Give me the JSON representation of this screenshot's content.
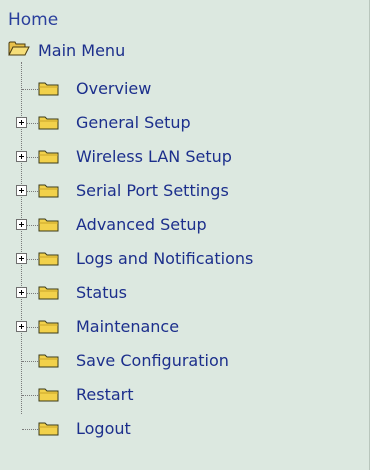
{
  "nav": {
    "home_label": "Home",
    "main_menu_label": "Main Menu",
    "items": [
      {
        "label": "Overview",
        "expandable": false
      },
      {
        "label": "General Setup",
        "expandable": true
      },
      {
        "label": "Wireless LAN Setup",
        "expandable": true
      },
      {
        "label": "Serial Port Settings",
        "expandable": true
      },
      {
        "label": "Advanced Setup",
        "expandable": true
      },
      {
        "label": "Logs and Notifications",
        "expandable": true
      },
      {
        "label": "Status",
        "expandable": true
      },
      {
        "label": "Maintenance",
        "expandable": true
      },
      {
        "label": "Save Configuration",
        "expandable": false
      },
      {
        "label": "Restart",
        "expandable": false
      },
      {
        "label": "Logout",
        "expandable": false
      }
    ]
  },
  "colors": {
    "background": "#dce8e0",
    "link": "#1c2f8c",
    "folder": "#f2d14b"
  },
  "icons": {
    "open_folder": "folder-open-icon",
    "folder": "folder-icon",
    "expander": "plus-box-icon"
  }
}
